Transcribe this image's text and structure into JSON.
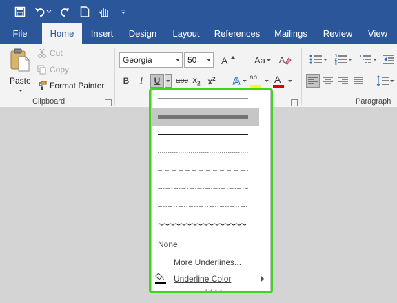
{
  "quick_access": {
    "items": [
      "save-icon",
      "undo-icon",
      "redo-icon",
      "new-document-icon",
      "touch-mode-icon",
      "customize-icon"
    ]
  },
  "tabs": [
    "File",
    "Home",
    "Insert",
    "Design",
    "Layout",
    "References",
    "Mailings",
    "Review",
    "View"
  ],
  "active_tab": "Home",
  "clipboard": {
    "paste_label": "Paste",
    "cut_label": "Cut",
    "copy_label": "Copy",
    "format_painter_label": "Format Painter",
    "group_label": "Clipboard"
  },
  "font": {
    "name": "Georgia",
    "size": "50",
    "bold_label": "B",
    "italic_label": "I",
    "underline_label": "U",
    "strike_label": "abc",
    "subscript_label": "x",
    "superscript_label": "x",
    "subscript_mark": "2",
    "superscript_mark": "2",
    "change_case_label": "Aa",
    "text_effects_label": "A",
    "font_color_label": "A",
    "highlight_label": "ab"
  },
  "paragraph": {
    "group_label": "Paragraph"
  },
  "underline_menu": {
    "styles": [
      "single",
      "double",
      "thick",
      "dotted",
      "dashed",
      "dash-dot",
      "dash-dot-dot",
      "wave"
    ],
    "selected_style": "double",
    "none_label": "None",
    "more_underlines_label": "More Underlines...",
    "underline_color_label": "Underline Color"
  },
  "colors": {
    "brand": "#2b579a",
    "highlight_frame": "#3cd61a",
    "ribbon": "#f3f3f3",
    "canvas": "#d4d4d4",
    "highlighter_yellow": "#ffff00",
    "font_color_red": "#e00000"
  }
}
